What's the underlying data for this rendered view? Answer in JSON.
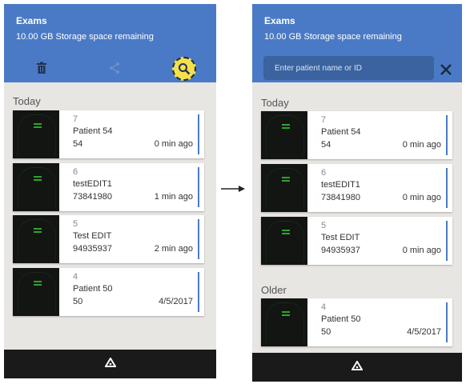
{
  "left": {
    "header": {
      "title": "Exams",
      "subtitle": "10.00 GB Storage space remaining"
    },
    "toolbar": {
      "icons": [
        "trash-icon",
        "share-icon",
        "search-icon"
      ],
      "search_highlight_color": "#f4e04d"
    },
    "sections": [
      {
        "label": "Today"
      }
    ],
    "cards": [
      {
        "number": "7",
        "name": "Patient 54",
        "id": "54",
        "time": "0 min ago"
      },
      {
        "number": "6",
        "name": "testEDIT1",
        "id": "73841980",
        "time": "1 min ago"
      },
      {
        "number": "5",
        "name": "Test EDIT",
        "id": "94935937",
        "time": "2 min ago"
      },
      {
        "number": "4",
        "name": "Patient 50",
        "id": "50",
        "time": "4/5/2017"
      }
    ]
  },
  "right": {
    "header": {
      "title": "Exams",
      "subtitle": "10.00 GB Storage space remaining"
    },
    "search": {
      "placeholder": "Enter patient name or ID"
    },
    "sections": [
      {
        "label": "Today"
      },
      {
        "label": "Older"
      }
    ],
    "cards": [
      {
        "number": "7",
        "name": "Patient 54",
        "id": "54",
        "time": "0 min ago"
      },
      {
        "number": "6",
        "name": "testEDIT1",
        "id": "73841980",
        "time": "0 min ago"
      },
      {
        "number": "5",
        "name": "Test EDIT",
        "id": "94935937",
        "time": "0 min ago"
      },
      {
        "number": "4",
        "name": "Patient 50",
        "id": "50",
        "time": "4/5/2017"
      }
    ]
  },
  "colors": {
    "accent": "#4a7ac5",
    "background": "#e8e6e3",
    "bottom_bar": "#1a1a1a"
  }
}
